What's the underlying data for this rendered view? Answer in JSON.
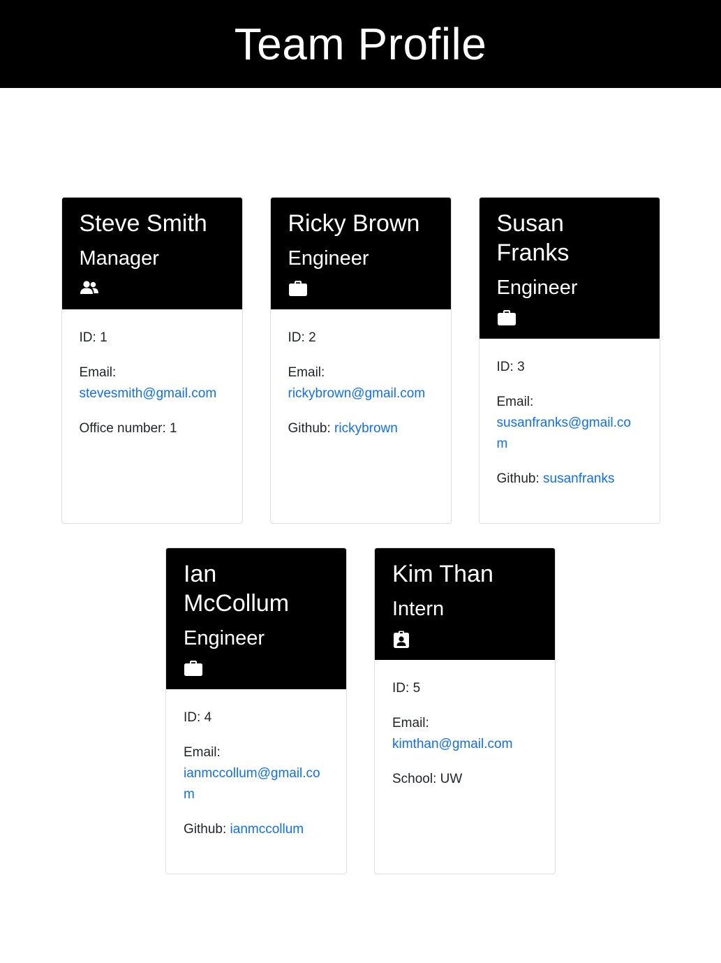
{
  "header": {
    "title": "Team Profile"
  },
  "labels": {
    "id": "ID: ",
    "email": "Email:",
    "office": "Office number: ",
    "github": "Github: ",
    "school": "School: "
  },
  "colors": {
    "header_bg": "#000000",
    "link": "#0d6efd"
  },
  "members": [
    {
      "name": "Steve Smith",
      "role": "Manager",
      "icon": "people-icon",
      "id": "1",
      "email": "stevesmith@gmail.com",
      "office": "1"
    },
    {
      "name": "Ricky Brown",
      "role": "Engineer",
      "icon": "briefcase-icon",
      "id": "2",
      "email": "rickybrown@gmail.com",
      "github": "rickybrown"
    },
    {
      "name": "Susan Franks",
      "role": "Engineer",
      "icon": "briefcase-icon",
      "id": "3",
      "email": "susanfranks@gmail.com",
      "github": "susanfranks"
    },
    {
      "name": "Ian McCollum",
      "role": "Engineer",
      "icon": "briefcase-icon",
      "id": "4",
      "email": "ianmccollum@gmail.com",
      "github": "ianmccollum"
    },
    {
      "name": "Kim Than",
      "role": "Intern",
      "icon": "id-badge-icon",
      "id": "5",
      "email": "kimthan@gmail.com",
      "school": "UW"
    }
  ]
}
